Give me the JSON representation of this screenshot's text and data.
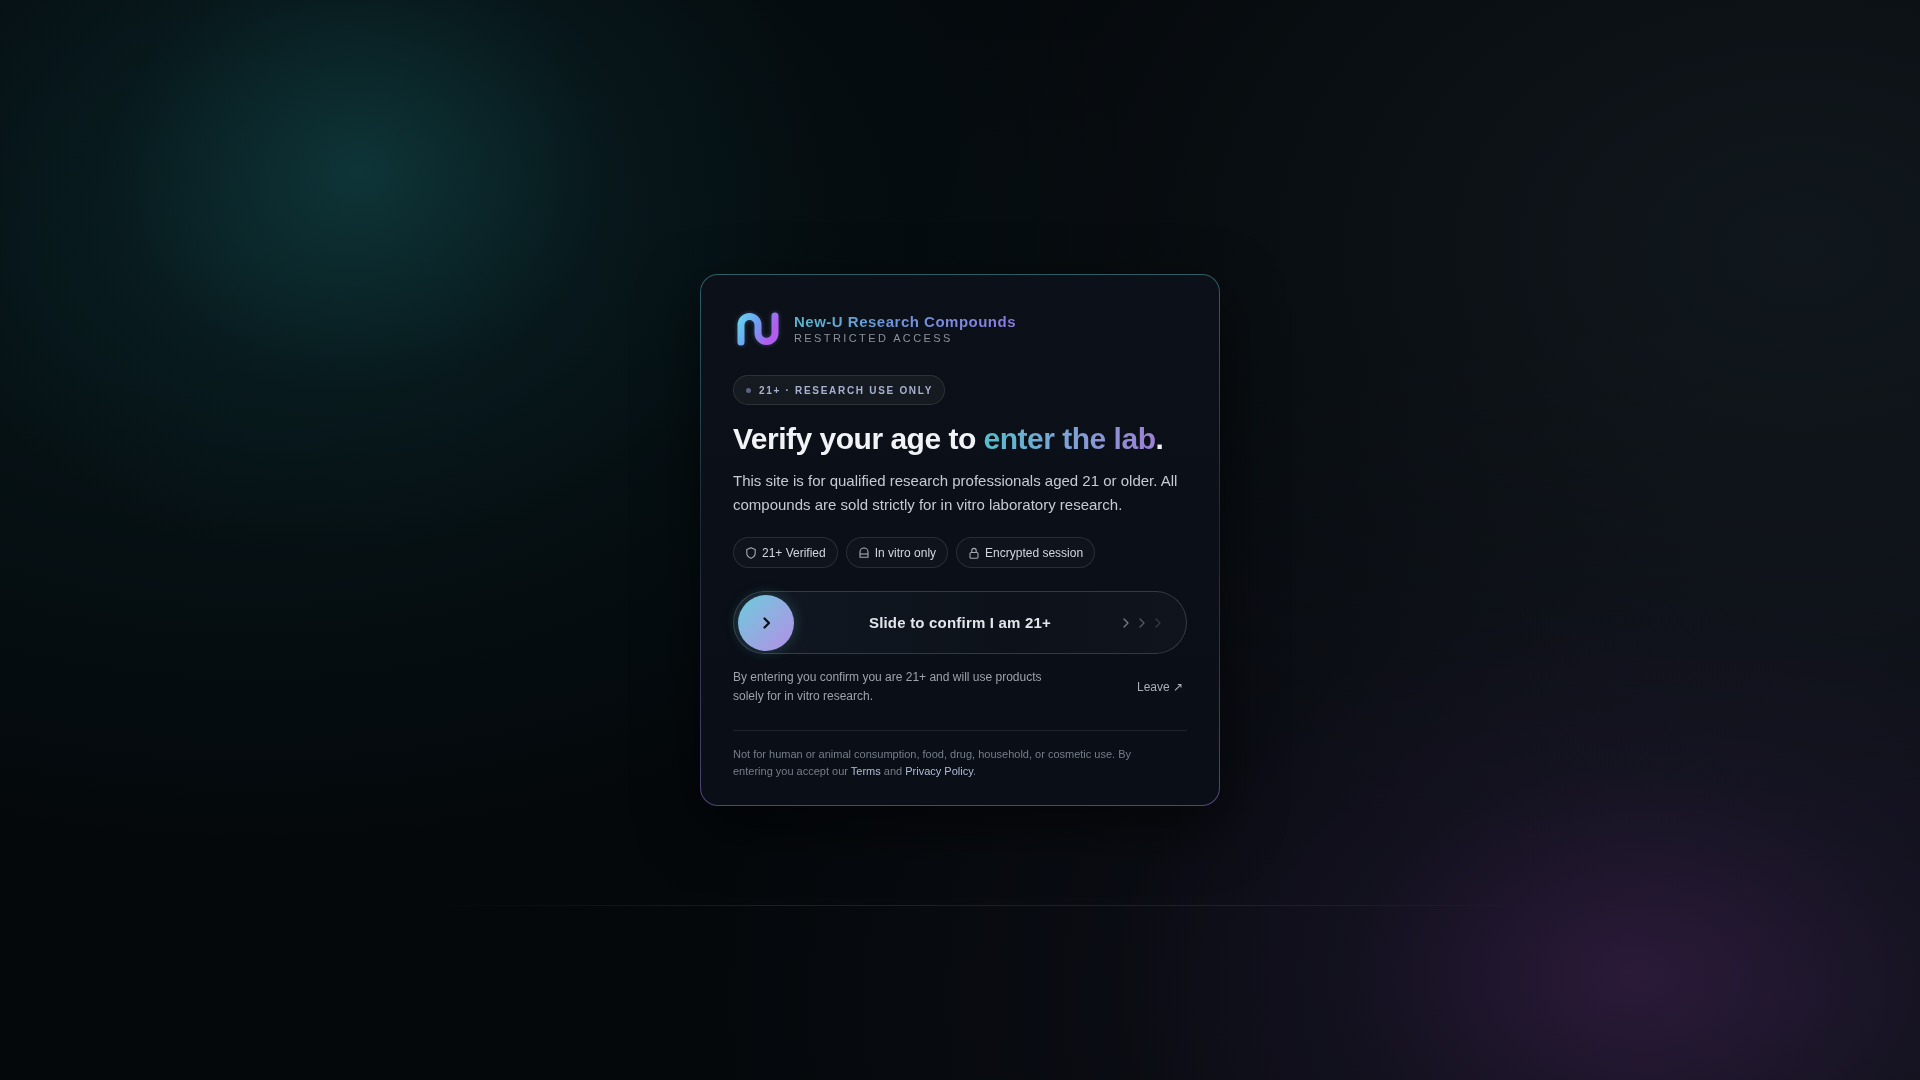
{
  "brand": {
    "name": "New-U Research Compounds",
    "tagline": "RESTRICTED ACCESS"
  },
  "badge": {
    "label": "21+ · RESEARCH USE ONLY"
  },
  "headline": {
    "lead": "Verify your age to ",
    "highlight": "enter the lab",
    "end": "."
  },
  "description": "This site is for qualified research professionals aged 21 or older. All compounds are sold strictly for in vitro laboratory research.",
  "features": [
    {
      "label": "21+ Verified"
    },
    {
      "label": "In vitro only"
    },
    {
      "label": "Encrypted session"
    }
  ],
  "slider": {
    "label": "Slide to confirm I am 21+",
    "level": 0
  },
  "consent_note": "By entering you confirm you are 21+ and will use products solely for in vitro research.",
  "leave_link": {
    "label": "Leave ↗"
  },
  "legal": [
    {
      "kind": "text",
      "text": "Not for human or animal consumption, food, drug, household, or cosmetic use. By entering you accept our "
    },
    {
      "kind": "link",
      "text": "Terms"
    },
    {
      "kind": "text",
      "text": " and "
    },
    {
      "kind": "link",
      "text": "Privacy Policy"
    },
    {
      "kind": "text",
      "text": "."
    }
  ]
}
